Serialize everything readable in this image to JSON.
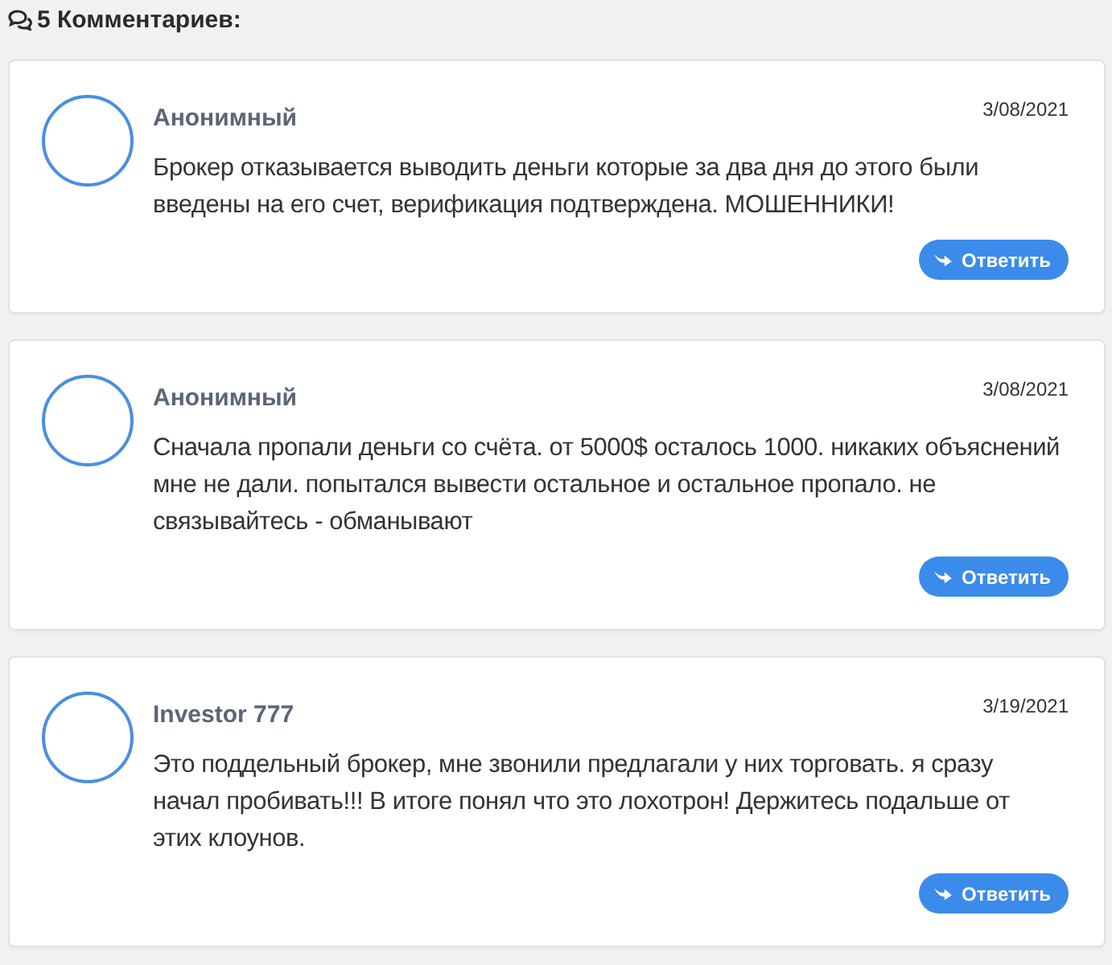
{
  "heading": {
    "text": "5 Комментариев:"
  },
  "comments": [
    {
      "author": "Анонимный",
      "date": "3/08/2021",
      "text": "Брокер отказывается выводить деньги которые за два дня до этого были введены на его счет, верификация подтверждена. МОШЕННИКИ!",
      "reply": "Ответить"
    },
    {
      "author": "Анонимный",
      "date": "3/08/2021",
      "text": "Сначала пропали деньги со счёта. от 5000$ осталось 1000. никаких объяснений мне не дали. попытался вывести остальное и остальное пропало. не связывайтесь - обманывают",
      "reply": "Ответить"
    },
    {
      "author": "Investor 777",
      "date": "3/19/2021",
      "text": "Это поддельный брокер, мне звонили предлагали у них торговать. я сразу начал пробивать!!! В итоге понял что это лохотрон! Держитесь подальше от этих клоунов.",
      "reply": "Ответить"
    }
  ]
}
